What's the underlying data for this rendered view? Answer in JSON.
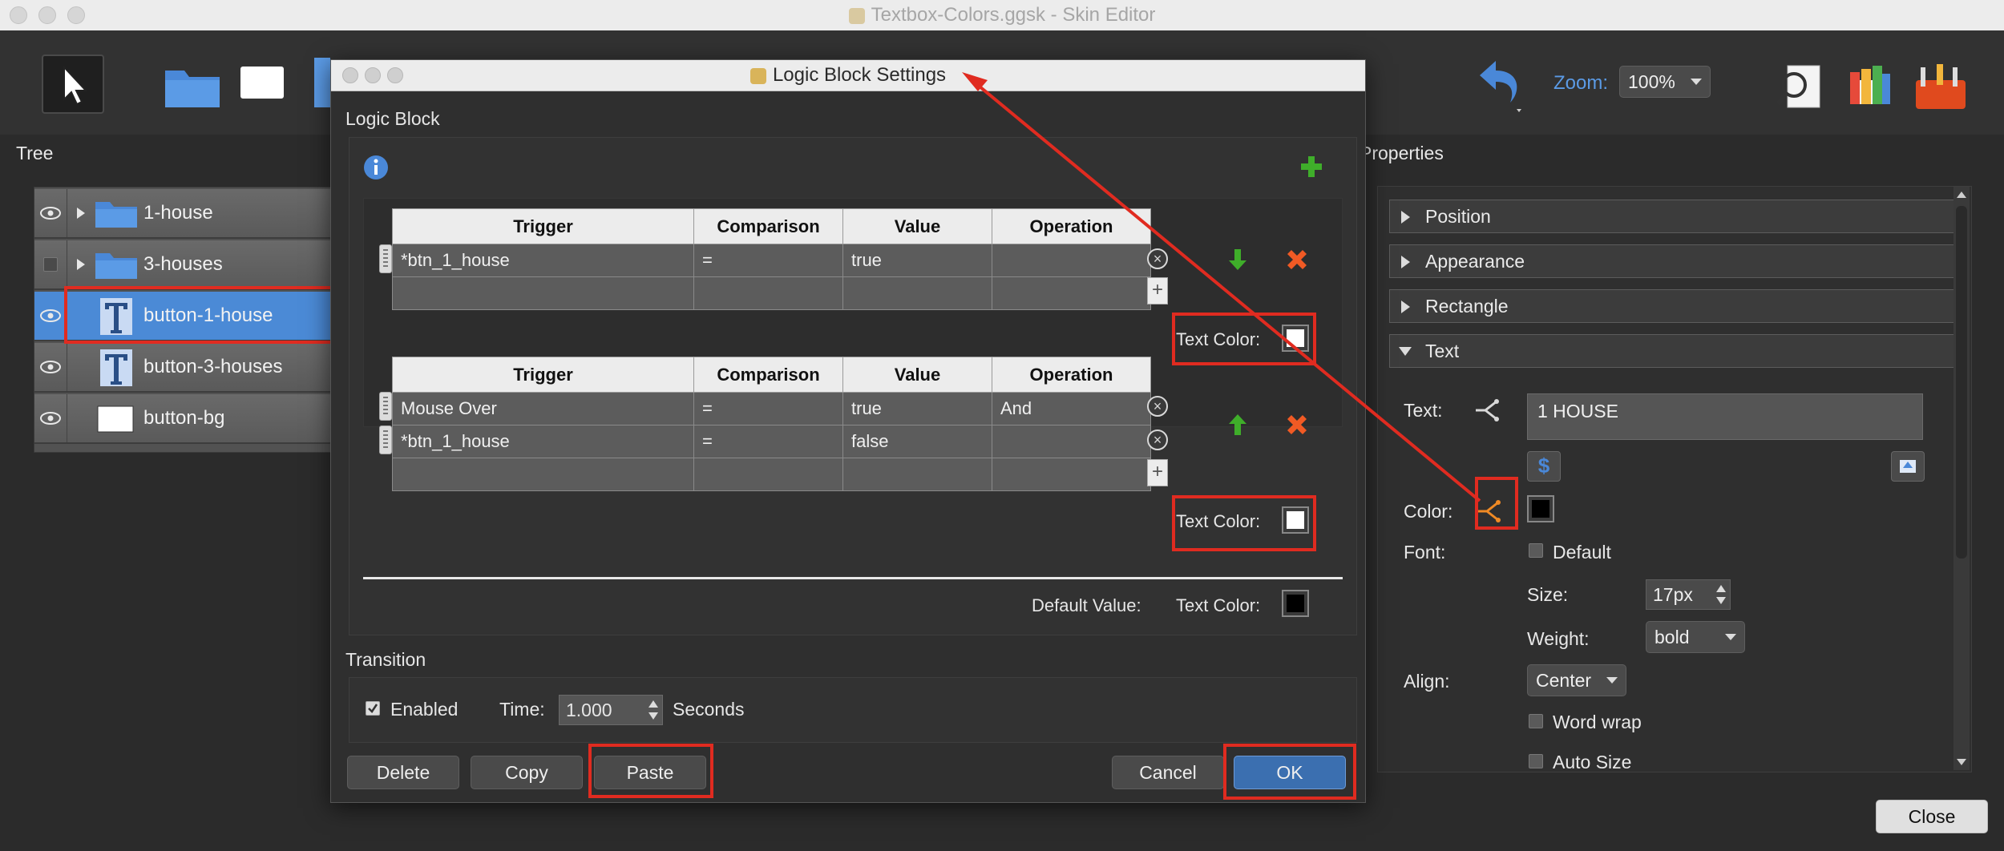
{
  "window": {
    "title": "Textbox-Colors.ggsk - Skin Editor"
  },
  "toolbar": {
    "zoom_label": "Zoom:",
    "zoom_value": "100%"
  },
  "tree": {
    "title": "Tree",
    "items": [
      {
        "label": "1-house",
        "visible": true,
        "icon": "folder-icon",
        "expandable": true
      },
      {
        "label": "3-houses",
        "visible": false,
        "icon": "folder-icon",
        "expandable": true
      },
      {
        "label": "button-1-house",
        "visible": true,
        "icon": "text-icon",
        "selected": true
      },
      {
        "label": "button-3-houses",
        "visible": true,
        "icon": "text-icon"
      },
      {
        "label": "button-bg",
        "visible": true,
        "icon": "rectangle-icon"
      }
    ]
  },
  "properties": {
    "title": "Properties",
    "sections": [
      "Position",
      "Appearance",
      "Rectangle",
      "Text"
    ],
    "text_label": "Text:",
    "text_value": "1 HOUSE",
    "color_label": "Color:",
    "color_value": "#000000",
    "font_label": "Font:",
    "font_default": "Default",
    "size_label": "Size:",
    "size_value": "17px",
    "weight_label": "Weight:",
    "weight_value": "bold",
    "align_label": "Align:",
    "align_value": "Center",
    "word_wrap": "Word wrap",
    "auto_size": "Auto Size"
  },
  "dialog": {
    "title": "Logic Block Settings",
    "logic_block_label": "Logic Block",
    "columns": [
      "Trigger",
      "Comparison",
      "Value",
      "Operation"
    ],
    "block1": {
      "rows": [
        [
          "*btn_1_house",
          "=",
          "true",
          ""
        ]
      ],
      "result_label": "Text Color:",
      "result_color": "#ffffff"
    },
    "block2": {
      "rows": [
        [
          "Mouse Over",
          "=",
          "true",
          "And"
        ],
        [
          "*btn_1_house",
          "=",
          "false",
          ""
        ]
      ],
      "result_label": "Text Color:",
      "result_color": "#ffffff"
    },
    "default_value_label": "Default Value:",
    "default_text_color_label": "Text Color:",
    "default_color": "#000000",
    "transition_label": "Transition",
    "enabled_label": "Enabled",
    "enabled": true,
    "time_label": "Time:",
    "time_value": "1.000",
    "seconds_label": "Seconds",
    "buttons": {
      "delete": "Delete",
      "copy": "Copy",
      "paste": "Paste",
      "cancel": "Cancel",
      "ok": "OK"
    }
  },
  "footer": {
    "close": "Close"
  },
  "colors": {
    "highlight": "#e02b20",
    "selection": "#4b8ad6",
    "add_green": "#3fae2a",
    "delete_orange": "#f15a24"
  }
}
